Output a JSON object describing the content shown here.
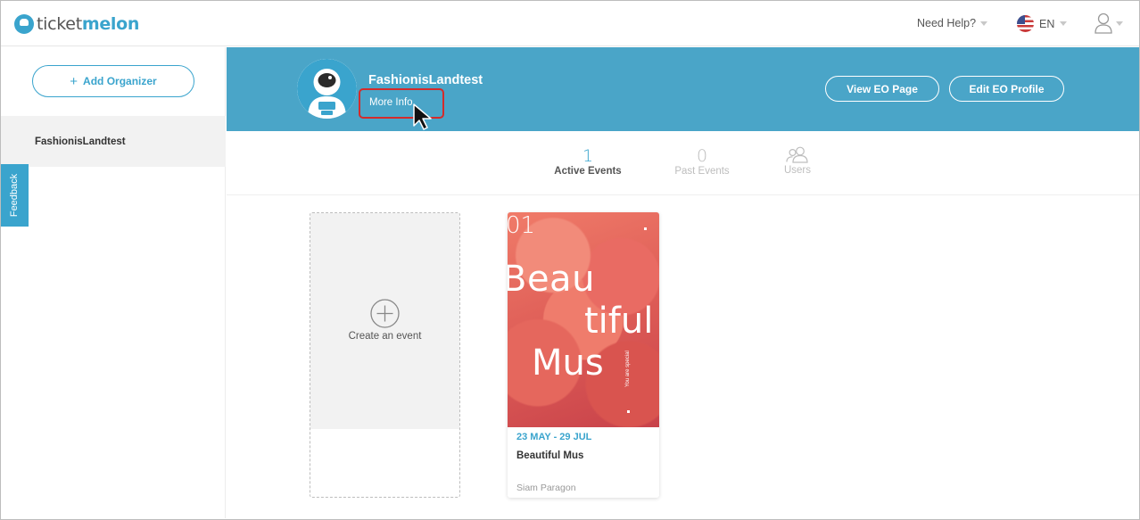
{
  "header": {
    "logo_text_1": "ticket",
    "logo_text_2": "melon",
    "help_label": "Need Help?",
    "language_label": "EN",
    "flag_icon": "us-flag-icon",
    "user_icon": "user-icon"
  },
  "sidebar": {
    "add_organizer_label": "Add Organizer",
    "organizers": [
      {
        "name": "FashionisLandtest"
      }
    ],
    "feedback_label": "Feedback"
  },
  "banner": {
    "organizer_name": "FashionisLandtest",
    "more_info_label": "More Info",
    "view_page_label": "View EO Page",
    "edit_profile_label": "Edit EO Profile",
    "background_color": "#4aa5c8"
  },
  "tabs": [
    {
      "count": "1",
      "label": "Active Events"
    },
    {
      "count": "0",
      "label": "Past Events"
    },
    {
      "icon": "users-icon",
      "label": "Users"
    }
  ],
  "create_card": {
    "label": "Create an event"
  },
  "events": [
    {
      "poster_number": "01",
      "poster_line_1": "Beau",
      "poster_line_2": "tiful",
      "poster_line_3": "Mus",
      "poster_side_text": "You are special",
      "date_range": "23 MAY - 29 JUL",
      "title": "Beautiful Mus",
      "venue": "Siam Paragon"
    }
  ],
  "colors": {
    "accent": "#3aa4cd",
    "highlight_border": "#d42b2b"
  }
}
